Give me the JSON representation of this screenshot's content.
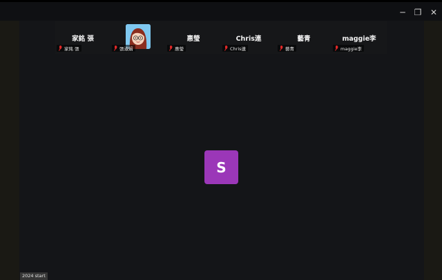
{
  "window": {
    "controls": {
      "minimize": "─",
      "restore": "❐",
      "close": "✕"
    }
  },
  "gallery": {
    "tiles": [
      {
        "name": "家銘 張",
        "label": "家銘 張",
        "muted": true,
        "has_avatar": false
      },
      {
        "name": "",
        "label": "張淑娟",
        "muted": true,
        "has_avatar": true
      },
      {
        "name": "惠瑩",
        "label": "惠瑩",
        "muted": true,
        "has_avatar": false
      },
      {
        "name": "Chris連",
        "label": "Chris連",
        "muted": true,
        "has_avatar": false
      },
      {
        "name": "藝青",
        "label": "藝青",
        "muted": true,
        "has_avatar": false
      },
      {
        "name": "maggie李",
        "label": "maggie李",
        "muted": true,
        "has_avatar": false
      }
    ]
  },
  "active_speaker": {
    "initial": "S",
    "color": "#9b37b8"
  },
  "footer": {
    "name_label": "2024 start"
  },
  "colors": {
    "background": "#141518",
    "muted_mic": "#e02828",
    "avatar_bg": "#7fc8f0"
  }
}
